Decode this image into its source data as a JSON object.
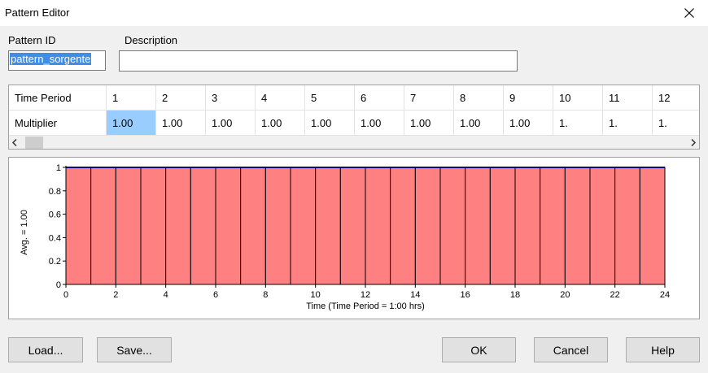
{
  "window": {
    "title": "Pattern Editor",
    "close_icon": "close-icon"
  },
  "form": {
    "pattern_id_label": "Pattern ID",
    "pattern_id_value": "pattern_sorgente",
    "description_label": "Description",
    "description_value": ""
  },
  "grid": {
    "row_labels": [
      "Time Period",
      "Multiplier"
    ],
    "periods": [
      "1",
      "2",
      "3",
      "4",
      "5",
      "6",
      "7",
      "8",
      "9",
      "10",
      "11",
      "12"
    ],
    "multipliers": [
      "1.00",
      "1.00",
      "1.00",
      "1.00",
      "1.00",
      "1.00",
      "1.00",
      "1.00",
      "1.00",
      "1.",
      "1.",
      "1."
    ],
    "selected_period": "1",
    "scroll_left_icon": "chevron-left-icon",
    "scroll_right_icon": "chevron-right-icon"
  },
  "chart_data": {
    "type": "bar",
    "categories": [
      "1",
      "2",
      "3",
      "4",
      "5",
      "6",
      "7",
      "8",
      "9",
      "10",
      "11",
      "12",
      "13",
      "14",
      "15",
      "16",
      "17",
      "18",
      "19",
      "20",
      "21",
      "22",
      "23",
      "24"
    ],
    "values": [
      1,
      1,
      1,
      1,
      1,
      1,
      1,
      1,
      1,
      1,
      1,
      1,
      1,
      1,
      1,
      1,
      1,
      1,
      1,
      1,
      1,
      1,
      1,
      1
    ],
    "xlabel": "Time (Time Period = 1:00 hrs)",
    "ylabel": "Avg. = 1.00",
    "xlim": [
      0,
      24
    ],
    "ylim": [
      0,
      1
    ],
    "xticks": [
      "0",
      "2",
      "4",
      "6",
      "8",
      "10",
      "12",
      "14",
      "16",
      "18",
      "20",
      "22",
      "24"
    ],
    "yticks": [
      "0",
      "0.2",
      "0.4",
      "0.6",
      "0.8",
      "1"
    ],
    "bar_color": "#ff8080",
    "line_color": "#000080",
    "grid": false,
    "legend": "none"
  },
  "buttons": {
    "load": "Load...",
    "save": "Save...",
    "ok": "OK",
    "cancel": "Cancel",
    "help": "Help"
  }
}
